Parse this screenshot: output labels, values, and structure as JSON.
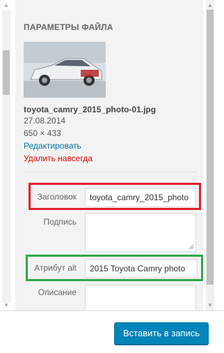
{
  "attachment_details": {
    "section_title": "ПАРАМЕТРЫ ФАЙЛА",
    "thumbnail_icon": "car-photo-thumbnail",
    "file_name": "toyota_camry_2015_photo-01.jpg",
    "upload_date": "27.08.2014",
    "dimensions": "650 × 433",
    "edit_link": "Редактировать",
    "delete_link": "Удалить навсегда",
    "link_color": "#0073aa",
    "delete_color": "#dd0000"
  },
  "fields": {
    "title_label": "Заголовок",
    "title_value": "toyota_camry_2015_photo",
    "caption_label": "Подпись",
    "caption_value": "",
    "alt_label": "Атрибут alt",
    "alt_value": "2015 Toyota Camry photo",
    "description_label": "Описание",
    "description_value": ""
  },
  "highlights": {
    "title_box_color": "#e0202d",
    "alt_box_color": "#2ea84a"
  },
  "footer": {
    "insert_button": "Вставить в запись",
    "button_color": "#0085ba"
  }
}
